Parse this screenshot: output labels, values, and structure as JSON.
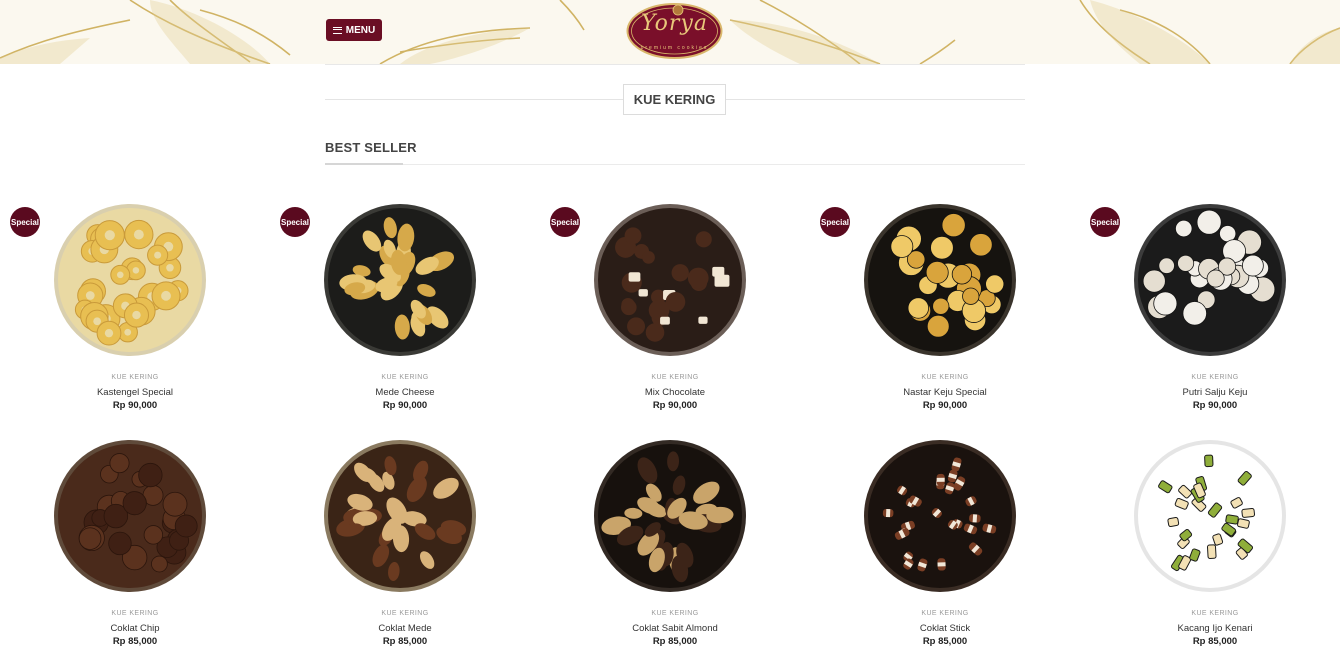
{
  "header": {
    "menu_label": "MENU",
    "logo_text": "Yorya",
    "logo_subtext": "premium cookies"
  },
  "category_title": "KUE KERING",
  "section_title": "BEST SELLER",
  "badge_label": "Special",
  "colors": {
    "brand": "#6a0e24",
    "badge": "#5a0a1f",
    "header_bg": "#fbf8ef",
    "leaf": "#c9a84c"
  },
  "products": [
    {
      "category": "KUE KERING",
      "name": "Kastengel Special",
      "price": "Rp 90,000",
      "special": true,
      "theme": "cheese-ring"
    },
    {
      "category": "KUE KERING",
      "name": "Mede Cheese",
      "price": "Rp 90,000",
      "special": true,
      "theme": "cheese-petal"
    },
    {
      "category": "KUE KERING",
      "name": "Mix Chocolate",
      "price": "Rp 90,000",
      "special": true,
      "theme": "mix-chocolate"
    },
    {
      "category": "KUE KERING",
      "name": "Nastar Keju Special",
      "price": "Rp 90,000",
      "special": true,
      "theme": "nastar"
    },
    {
      "category": "KUE KERING",
      "name": "Putri Salju Keju",
      "price": "Rp 90,000",
      "special": true,
      "theme": "snow"
    },
    {
      "category": "KUE KERING",
      "name": "Coklat Chip",
      "price": "Rp 85,000",
      "special": false,
      "theme": "choco-chip"
    },
    {
      "category": "KUE KERING",
      "name": "Coklat Mede",
      "price": "Rp 85,000",
      "special": false,
      "theme": "cashew"
    },
    {
      "category": "KUE KERING",
      "name": "Coklat Sabit Almond",
      "price": "Rp 85,000",
      "special": false,
      "theme": "almond"
    },
    {
      "category": "KUE KERING",
      "name": "Coklat Stick",
      "price": "Rp 85,000",
      "special": false,
      "theme": "stick"
    },
    {
      "category": "KUE KERING",
      "name": "Kacang Ijo Kenari",
      "price": "Rp 85,000",
      "special": false,
      "theme": "green"
    }
  ]
}
